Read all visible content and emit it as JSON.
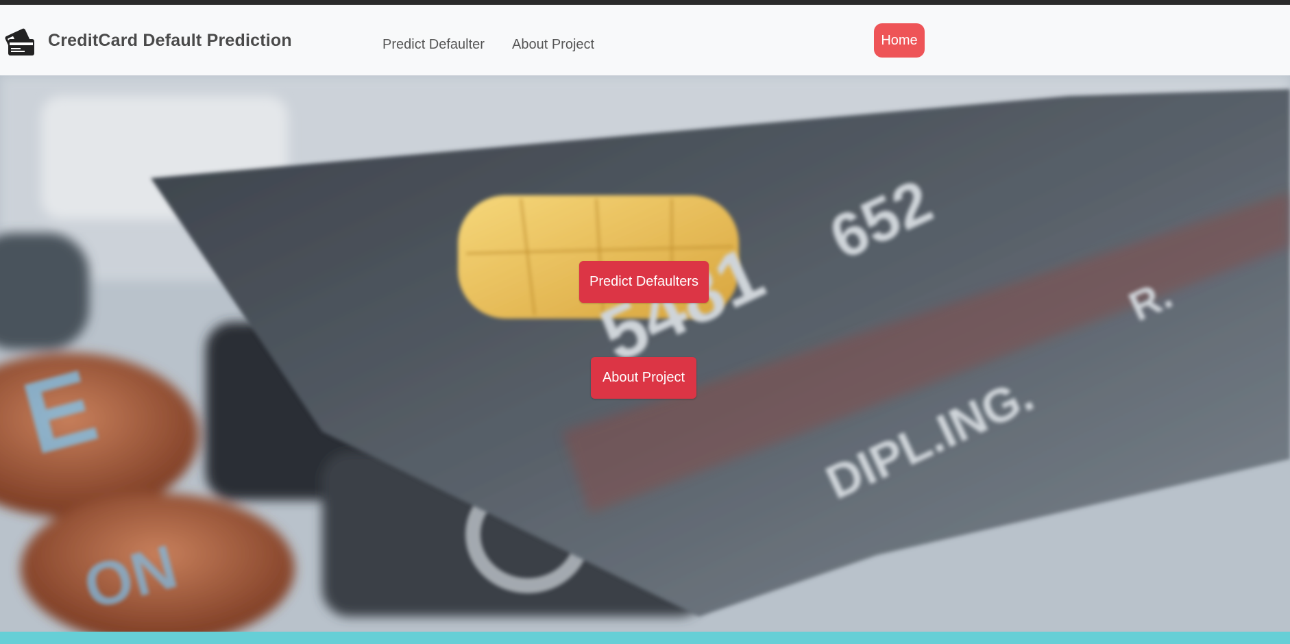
{
  "navbar": {
    "brand_title": "CreditCard Default Prediction",
    "brand_icon": "credit-card-icon",
    "links": [
      {
        "label": "Predict Defaulter"
      },
      {
        "label": "About Project"
      }
    ],
    "home_label": "Home",
    "home_color": "#ee5457"
  },
  "hero": {
    "buttons": [
      {
        "label": "Predict Defaulters"
      },
      {
        "label": "About Project"
      }
    ],
    "button_color": "#dc3545",
    "background_subject": "blurred credit card on calculator keys"
  },
  "colors": {
    "navbar_bg": "#f8f9fa",
    "bottom_strip": "#66cfd6",
    "top_strip": "#2b2b2b"
  }
}
